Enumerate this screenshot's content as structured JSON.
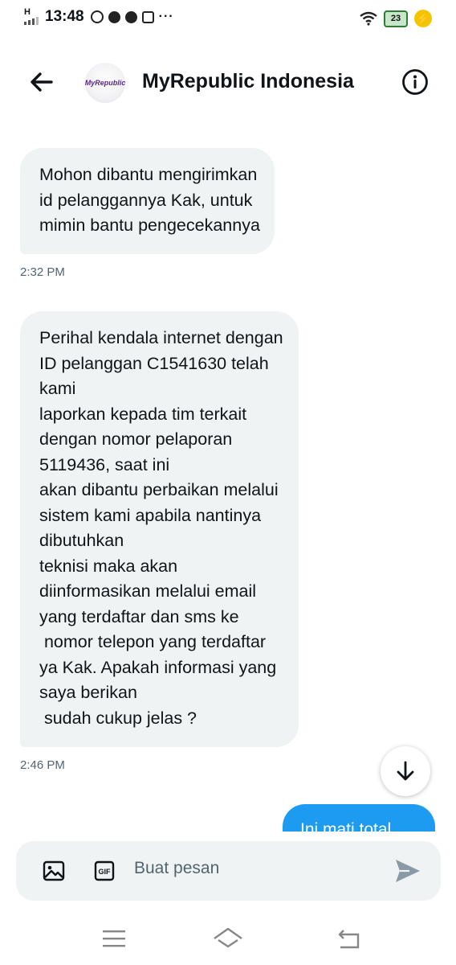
{
  "status_bar": {
    "network": "H",
    "time": "13:48",
    "more": "···",
    "battery": "23"
  },
  "header": {
    "title": "MyRepublic Indonesia",
    "avatar_text": "MyRepublic",
    "brand_color": "#5b2a86"
  },
  "messages": [
    {
      "text": "Mohon dibantu mengirimkan\nid pelanggannya Kak, untuk\nmimin bantu pengecekannya",
      "time": "2:32 PM"
    },
    {
      "text": "Perihal kendala internet dengan\nID pelanggan C1541630 telah\nkami\nlaporkan kepada tim terkait\ndengan nomor pelaporan\n5119436, saat ini\nakan dibantu perbaikan melalui\nsistem kami apabila nantinya\ndibutuhkan\nteknisi maka akan\ndiinformasikan melalui email\nyang terdaftar dan sms ke\n nomor telepon yang terdaftar\nya Kak. Apakah informasi yang\nsaya berikan\n sudah cukup jelas ?",
      "time": "2:46 PM"
    }
  ],
  "outgoing": {
    "text": "Ini mati total"
  },
  "composer": {
    "placeholder": "Buat pesan",
    "gif_label": "GIF"
  },
  "colors": {
    "incoming_bubble": "#eff3f4",
    "outgoing_bubble": "#1d9bf0",
    "timestamp": "#536471"
  }
}
